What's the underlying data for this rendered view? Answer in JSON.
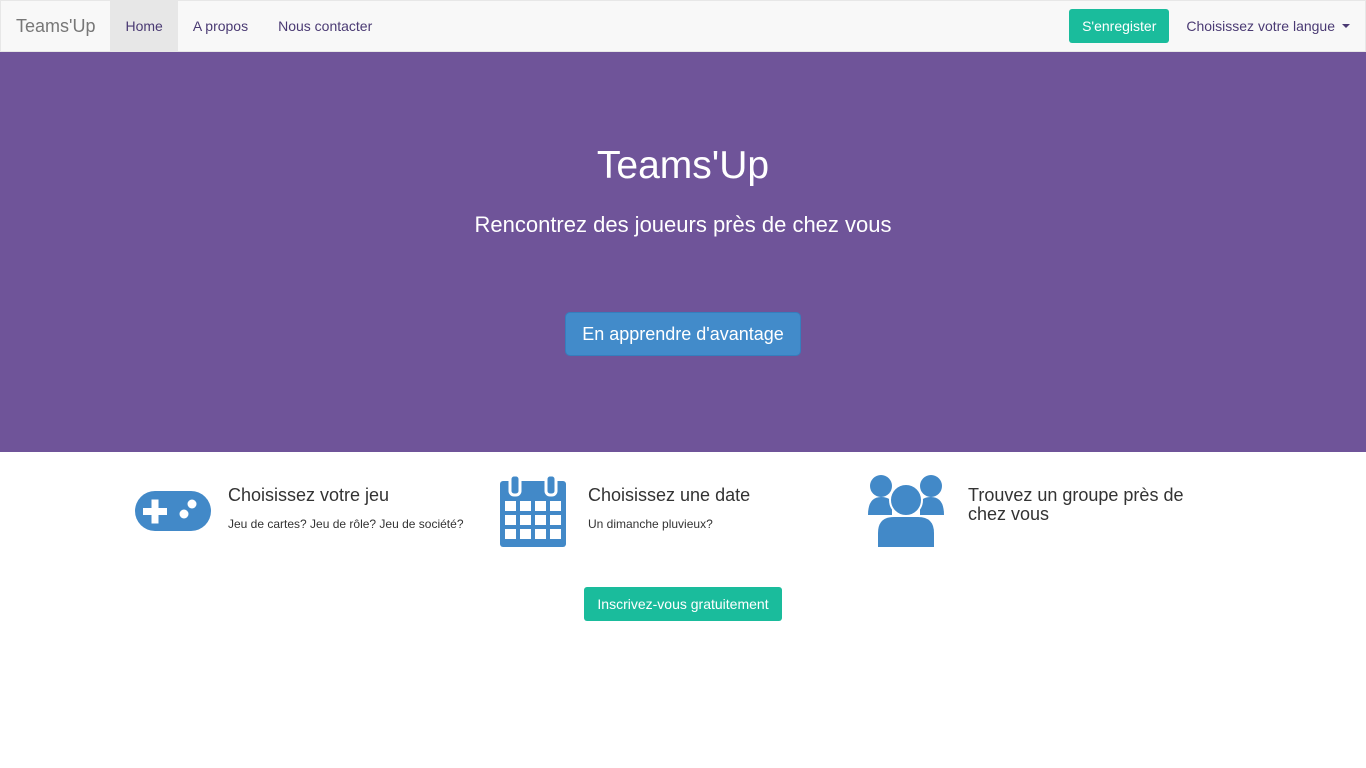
{
  "navbar": {
    "brand": "Teams'Up",
    "links": [
      {
        "label": "Home",
        "active": true
      },
      {
        "label": "A propos"
      },
      {
        "label": "Nous contacter"
      }
    ],
    "register_label": "S'enregister",
    "language_label": "Choisissez votre langue"
  },
  "hero": {
    "title": "Teams'Up",
    "subtitle": "Rencontrez des joueurs près de chez vous",
    "cta_label": "En apprendre d'avantage"
  },
  "features": [
    {
      "icon": "gamepad-icon",
      "title": "Choisissez votre jeu",
      "desc": "Jeu de cartes? Jeu de rôle? Jeu de société?"
    },
    {
      "icon": "calendar-icon",
      "title": "Choisissez une date",
      "desc": "Un dimanche pluvieux?"
    },
    {
      "icon": "users-icon",
      "title": "Trouvez un groupe près de chez vous",
      "desc": ""
    }
  ],
  "signup_label": "Inscrivez-vous gratuitement",
  "colors": {
    "hero_bg": "#6f5499",
    "accent_green": "#1abc9c",
    "primary_blue": "#428bca",
    "icon_blue": "#4289c8"
  }
}
